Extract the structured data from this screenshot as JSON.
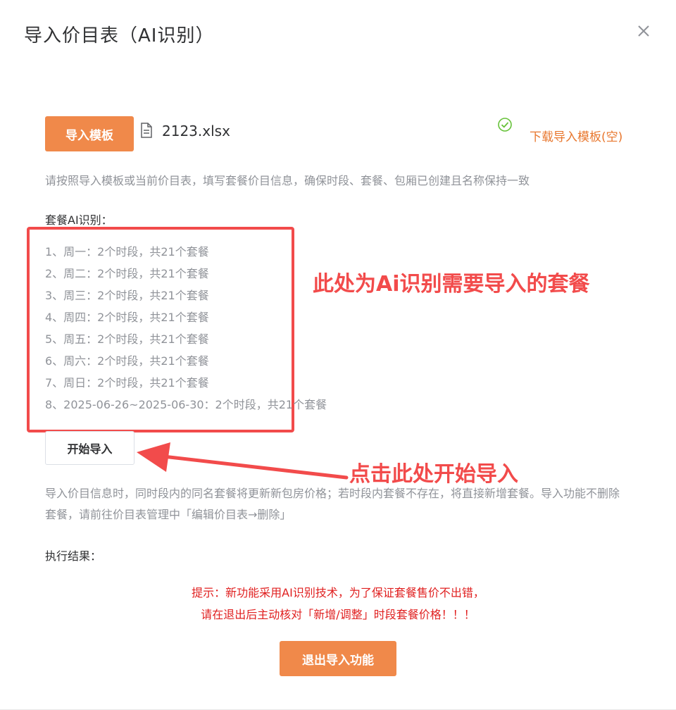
{
  "dialog": {
    "title": "导入价目表（AI识别）"
  },
  "import": {
    "template_button": "导入模板",
    "file_name": "2123.xlsx",
    "download_link": "下载导入模板(空)",
    "hint": "请按照导入模板或当前价目表，填写套餐价目信息，确保时段、套餐、包厢已创建且名称保持一致"
  },
  "ai": {
    "label": "套餐AI识别：",
    "items": [
      "1、周一：2个时段，共21个套餐",
      "2、周二：2个时段，共21个套餐",
      "3、周三：2个时段，共21个套餐",
      "4、周四：2个时段，共21个套餐",
      "5、周五：2个时段，共21个套餐",
      "6、周六：2个时段，共21个套餐",
      "7、周日：2个时段，共21个套餐",
      "8、2025-06-26~2025-06-30：2个时段，共21个套餐"
    ]
  },
  "annotations": {
    "ai_note": "此处为Ai识别需要导入的套餐",
    "start_note": "点击此处开始导入",
    "color": "#f24b4b"
  },
  "start_button": "开始导入",
  "notice": "导入价目信息时，同时段内的同名套餐将更新新包房价格；若时段内套餐不存在，将直接新增套餐。导入功能不删除套餐，请前往价目表管理中「编辑价目表→删除」",
  "result": {
    "label": "执行结果："
  },
  "tip": {
    "line1": "提示：新功能采用AI识别技术，为了保证套餐售价不出错，",
    "line2": "请在退出后主动核对「新增/调整」时段套餐价格！！！"
  },
  "exit_button": "退出导入功能",
  "colors": {
    "accent": "#f0894a",
    "link": "#e8772e",
    "success": "#67c23a",
    "tip": "#e02020"
  },
  "icons": {
    "close": "close-icon",
    "file": "file-icon",
    "check": "check-circle-icon"
  }
}
